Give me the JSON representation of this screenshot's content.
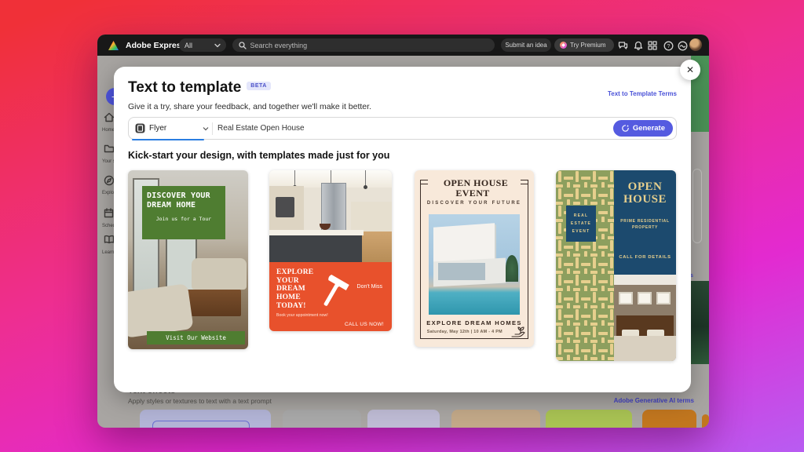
{
  "topbar": {
    "brand": "Adobe Express",
    "scope_dropdown": "All",
    "search_placeholder": "Search everything",
    "submit_idea_label": "Submit an idea",
    "try_premium_label": "Try Premium"
  },
  "sidebar": {
    "items": [
      {
        "label": "Home"
      },
      {
        "label": "Your stuff"
      },
      {
        "label": "Explore"
      },
      {
        "label": "Schedule"
      },
      {
        "label": "Learn"
      }
    ]
  },
  "modal": {
    "title": "Text to template",
    "beta_badge": "BETA",
    "terms_link": "Text to Template Terms",
    "subtitle": "Give it a try, share your feedback, and together we'll make it better.",
    "type_selector_value": "Flyer",
    "prompt_value": "Real Estate Open House",
    "generate_label": "Generate",
    "section_heading": "Kick-start your design, with templates made just for you",
    "close_glyph": "✕",
    "templates": [
      {
        "headline": "DISCOVER YOUR DREAM HOME",
        "subtext": "Join us for a Tour",
        "footer": "Visit Our Website"
      },
      {
        "headline": "EXPLORE YOUR DREAM HOME TODAY!",
        "subtext": "Book your appointment now!",
        "tag": "Don't Miss",
        "cta": "CALL US NOW!"
      },
      {
        "headline": "OPEN HOUSE EVENT",
        "tagline": "DISCOVER YOUR FUTURE",
        "footer": "EXPLORE DREAM HOMES",
        "schedule": "Saturday, May 12th | 10 AM - 4 PM"
      },
      {
        "badge": "REAL ESTATE EVENT",
        "headline": "OPEN HOUSE",
        "subtext": "PRIME RESIDENTIAL PROPERTY",
        "cta": "CALL FOR DETAILS"
      }
    ]
  },
  "background_page": {
    "text_effects_heading": "Text effects",
    "text_effects_subtitle": "Apply styles or textures to text with a text prompt",
    "generative_terms_link": "Adobe Generative AI terms",
    "partial_terms_text": "rms"
  },
  "colors": {
    "accent_blue": "#555be0",
    "template1_green": "#4f7d31",
    "template2_orange": "#e8512c",
    "template3_cream": "#f8e9da",
    "template4_olive": "#8d9f5e",
    "template4_navy": "#1c4a6e",
    "template4_tan": "#e6cf8d",
    "swatches": [
      "#b2b4d6",
      "#a8a8a8",
      "#bebbd4",
      "#c2a888",
      "#a8c253",
      "#c1761f"
    ]
  }
}
